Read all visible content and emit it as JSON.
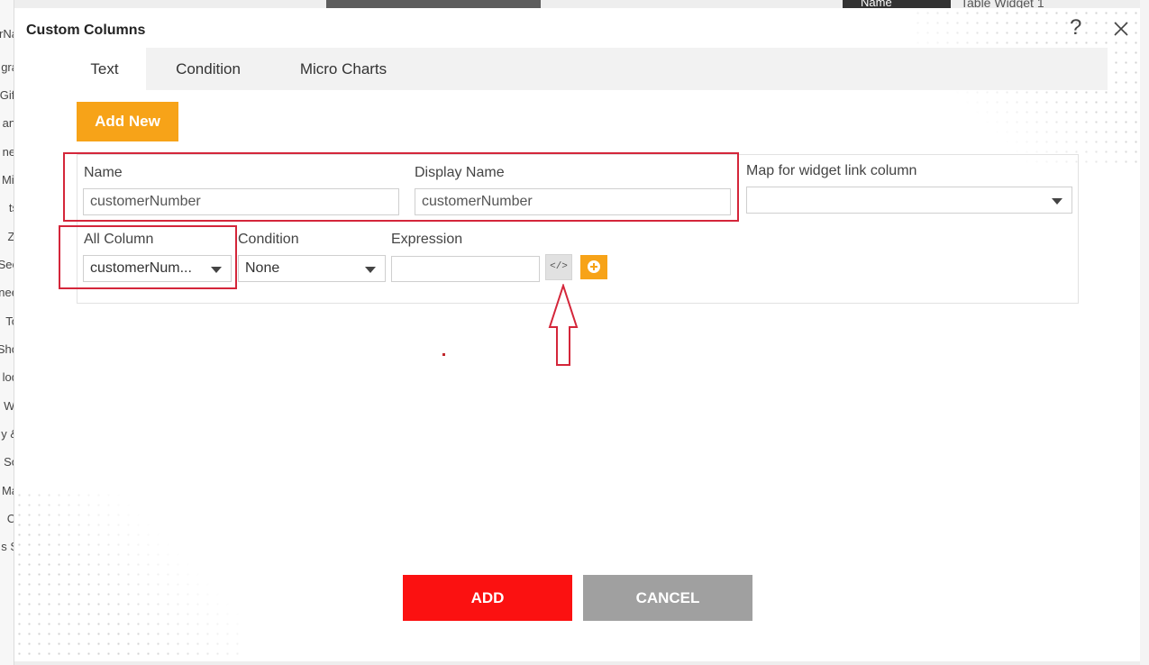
{
  "background": {
    "left_items": [
      "erNa",
      "gra",
      "Gift",
      "ani",
      "nel",
      "Mir",
      "ts",
      "ZI",
      "Sec",
      "nee",
      "To",
      "Sho",
      "lod",
      "WI",
      "y &",
      "So",
      "Ma",
      "Cl",
      "s S"
    ],
    "top_tabs": [
      "Name",
      "Table Widget 1"
    ]
  },
  "modal": {
    "title": "Custom Columns",
    "help_icon": "question-mark-icon",
    "close_icon": "close-icon"
  },
  "tabs": [
    {
      "label": "Text",
      "active": true
    },
    {
      "label": "Condition",
      "active": false
    },
    {
      "label": "Micro Charts",
      "active": false
    }
  ],
  "add_new_label": "Add New",
  "form": {
    "name_label": "Name",
    "name_value": "customerNumber",
    "display_name_label": "Display Name",
    "display_name_value": "customerNumber",
    "map_label": "Map for widget link column",
    "map_value": "",
    "all_column_label": "All Column",
    "all_column_value": "customerNum...",
    "condition_label": "Condition",
    "condition_value": "None",
    "expression_label": "Expression",
    "expression_value": "",
    "code_button_glyph": "</>",
    "code_icon": "code-icon",
    "add_row_icon": "plus-circle-icon"
  },
  "footer": {
    "add_label": "ADD",
    "cancel_label": "CANCEL"
  },
  "colors": {
    "accent_orange": "#f7a318",
    "highlight_red": "#d4263a",
    "add_button_red": "#fb1111",
    "cancel_gray": "#a0a0a0"
  }
}
